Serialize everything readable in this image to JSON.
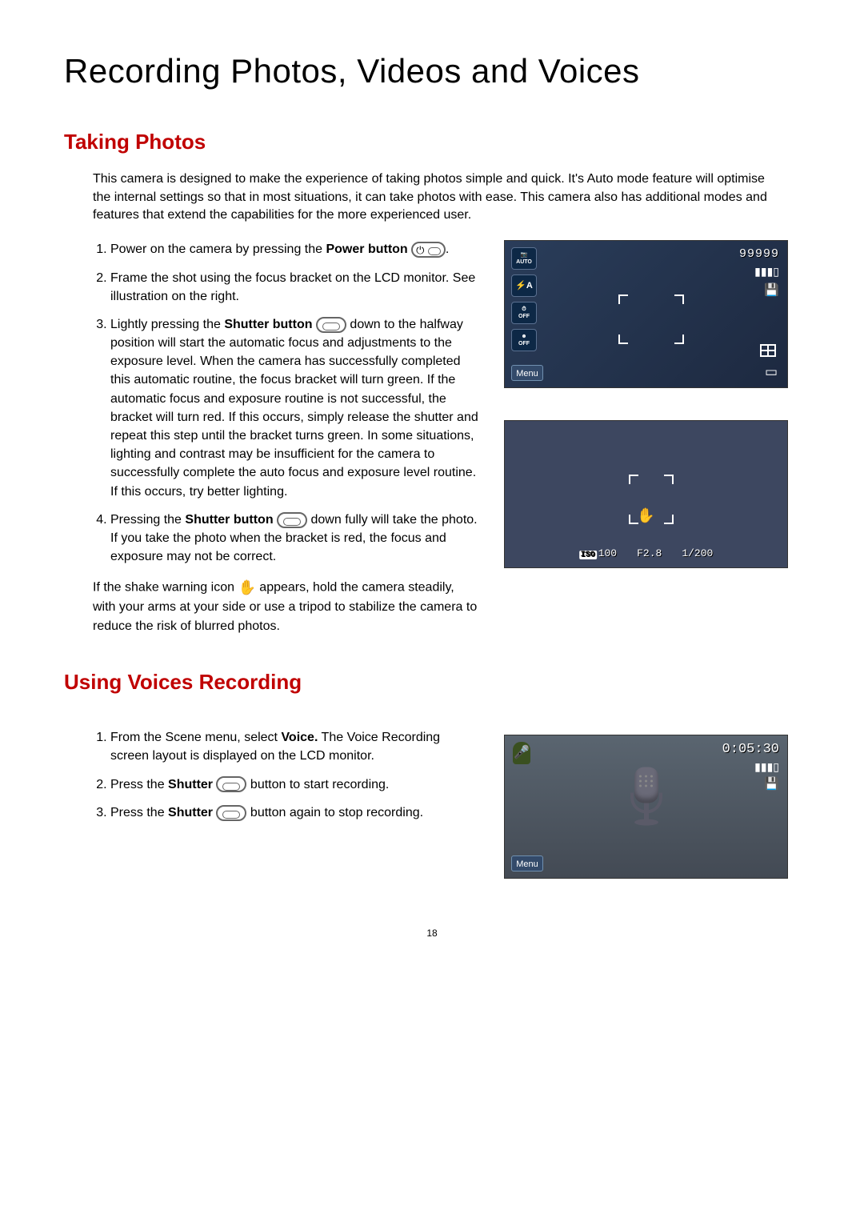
{
  "page_title": "Recording Photos, Videos and Voices",
  "section1": {
    "heading": "Taking Photos",
    "intro": "This camera is designed to make the experience of taking photos simple and quick.  It's Auto mode feature will optimise the internal settings so that in most situations, it can take photos with ease.  This camera also has additional modes and features that extend the capabilities for the more experienced user.",
    "step1_a": "Power on the camera by pressing the ",
    "step1_b": "Power button",
    "step1_c": ".",
    "step2": "Frame the shot using the focus bracket on the LCD monitor. See illustration on the right.",
    "step3_a": "Lightly pressing the ",
    "step3_b": "Shutter button",
    "step3_c": " down to the halfway position will start the automatic focus and adjustments to the exposure level.  When the camera has successfully completed this automatic routine, the focus bracket will turn green.  If the automatic focus and exposure routine is not successful, the bracket will turn red.  If this occurs, simply release the shutter and repeat this step until the bracket turns green.  In some situations, lighting and contrast may be insufficient for the camera to successfully complete the auto focus and exposure level routine.  If this occurs, try better lighting.",
    "step4_a": "Pressing the ",
    "step4_b": "Shutter button",
    "step4_c": " down fully will take the photo.  If you take the photo when the bracket is red, the focus and exposure may not be correct.",
    "shake_a": "If the shake warning icon ",
    "shake_b": " appears, hold the camera steadily, with your arms at your side or use a tripod to stabilize the camera to reduce the risk of blurred photos."
  },
  "section2": {
    "heading": "Using Voices Recording",
    "step1_a": "From the Scene menu, select ",
    "step1_b": "Voice.",
    "step1_c": " The Voice Recording screen layout is displayed on the LCD monitor.",
    "step2_a": "Press the ",
    "step2_b": "Shutter",
    "step2_c": " button to start recording.",
    "step3_a": "Press the ",
    "step3_b": "Shutter",
    "step3_c": " button again to stop recording."
  },
  "lcd1": {
    "auto": "AUTO",
    "flash": "⚡A",
    "selftimer": "OFF",
    "face": "OFF",
    "menu": "Menu",
    "counter": "99999"
  },
  "lcd2": {
    "iso_label": "ISO",
    "iso": "100",
    "fnum": "F2.8",
    "shutter": "1/200"
  },
  "lcd3": {
    "menu": "Menu",
    "timer": "0:05:30"
  },
  "page_number": "18"
}
